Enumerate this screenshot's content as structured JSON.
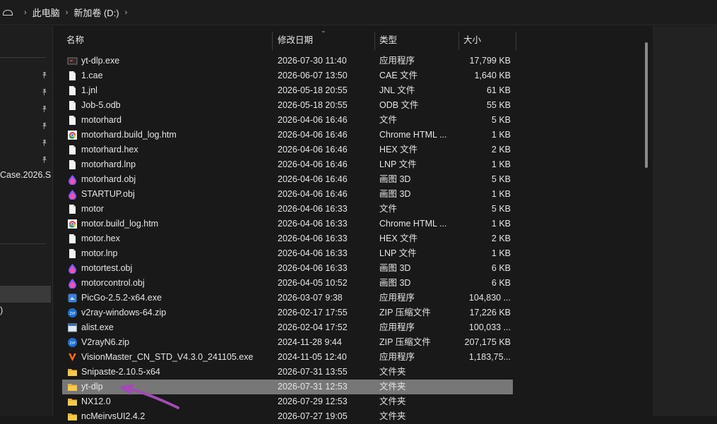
{
  "breadcrumb": {
    "items": [
      "此电脑",
      "新加卷 (D:)"
    ]
  },
  "nav": {
    "partial_label_1": "Case.2026.S",
    "partial_label_2": ")"
  },
  "columns": {
    "name": "名称",
    "date": "修改日期",
    "type": "类型",
    "size": "大小"
  },
  "files": [
    {
      "name": "yt-dlp.exe",
      "date": "2026-07-30 11:40",
      "type": "应用程序",
      "size": "17,799 KB",
      "icon": "exe-icon"
    },
    {
      "name": "1.cae",
      "date": "2026-06-07 13:50",
      "type": "CAE 文件",
      "size": "1,640 KB",
      "icon": "file-icon"
    },
    {
      "name": "1.jnl",
      "date": "2026-05-18 20:55",
      "type": "JNL 文件",
      "size": "61 KB",
      "icon": "file-icon"
    },
    {
      "name": "Job-5.odb",
      "date": "2026-05-18 20:55",
      "type": "ODB 文件",
      "size": "55 KB",
      "icon": "file-icon"
    },
    {
      "name": "motorhard",
      "date": "2026-04-06 16:46",
      "type": "文件",
      "size": "5 KB",
      "icon": "file-icon"
    },
    {
      "name": "motorhard.build_log.htm",
      "date": "2026-04-06 16:46",
      "type": "Chrome HTML ...",
      "size": "1 KB",
      "icon": "chrome-icon"
    },
    {
      "name": "motorhard.hex",
      "date": "2026-04-06 16:46",
      "type": "HEX 文件",
      "size": "2 KB",
      "icon": "file-icon"
    },
    {
      "name": "motorhard.lnp",
      "date": "2026-04-06 16:46",
      "type": "LNP 文件",
      "size": "1 KB",
      "icon": "file-icon"
    },
    {
      "name": "motorhard.obj",
      "date": "2026-04-06 16:46",
      "type": "画图 3D",
      "size": "5 KB",
      "icon": "paint3d-icon"
    },
    {
      "name": "STARTUP.obj",
      "date": "2026-04-06 16:46",
      "type": "画图 3D",
      "size": "1 KB",
      "icon": "paint3d-icon"
    },
    {
      "name": "motor",
      "date": "2026-04-06 16:33",
      "type": "文件",
      "size": "5 KB",
      "icon": "file-icon"
    },
    {
      "name": "motor.build_log.htm",
      "date": "2026-04-06 16:33",
      "type": "Chrome HTML ...",
      "size": "1 KB",
      "icon": "chrome-icon"
    },
    {
      "name": "motor.hex",
      "date": "2026-04-06 16:33",
      "type": "HEX 文件",
      "size": "2 KB",
      "icon": "file-icon"
    },
    {
      "name": "motor.lnp",
      "date": "2026-04-06 16:33",
      "type": "LNP 文件",
      "size": "1 KB",
      "icon": "file-icon"
    },
    {
      "name": "motortest.obj",
      "date": "2026-04-06 16:33",
      "type": "画图 3D",
      "size": "6 KB",
      "icon": "paint3d-icon"
    },
    {
      "name": "motorcontrol.obj",
      "date": "2026-04-05 10:52",
      "type": "画图 3D",
      "size": "6 KB",
      "icon": "paint3d-icon"
    },
    {
      "name": "PicGo-2.5.2-x64.exe",
      "date": "2026-03-07 9:38",
      "type": "应用程序",
      "size": "104,830 ...",
      "icon": "app-icon"
    },
    {
      "name": "v2ray-windows-64.zip",
      "date": "2026-02-17 17:55",
      "type": "ZIP 压缩文件",
      "size": "17,226 KB",
      "icon": "zip-icon"
    },
    {
      "name": "alist.exe",
      "date": "2026-02-04 17:52",
      "type": "应用程序",
      "size": "100,033 ...",
      "icon": "window-app-icon"
    },
    {
      "name": "V2rayN6.zip",
      "date": "2024-11-28 9:44",
      "type": "ZIP 压缩文件",
      "size": "207,175 KB",
      "icon": "zip-icon"
    },
    {
      "name": "VisionMaster_CN_STD_V4.3.0_241105.exe",
      "date": "2024-11-05 12:40",
      "type": "应用程序",
      "size": "1,183,75...",
      "icon": "visionmaster-icon"
    },
    {
      "name": "Snipaste-2.10.5-x64",
      "date": "2026-07-31 13:55",
      "type": "文件夹",
      "size": "",
      "icon": "folder-icon"
    },
    {
      "name": "yt-dlp",
      "date": "2026-07-31 12:53",
      "type": "文件夹",
      "size": "",
      "icon": "folder-icon",
      "selected": true
    },
    {
      "name": "NX12.0",
      "date": "2026-07-29 12:53",
      "type": "文件夹",
      "size": "",
      "icon": "folder-icon"
    },
    {
      "name": "ncMeirvsUI2.4.2",
      "date": "2026-07-27 19:05",
      "type": "文件夹",
      "size": "",
      "icon": "folder-icon"
    }
  ]
}
